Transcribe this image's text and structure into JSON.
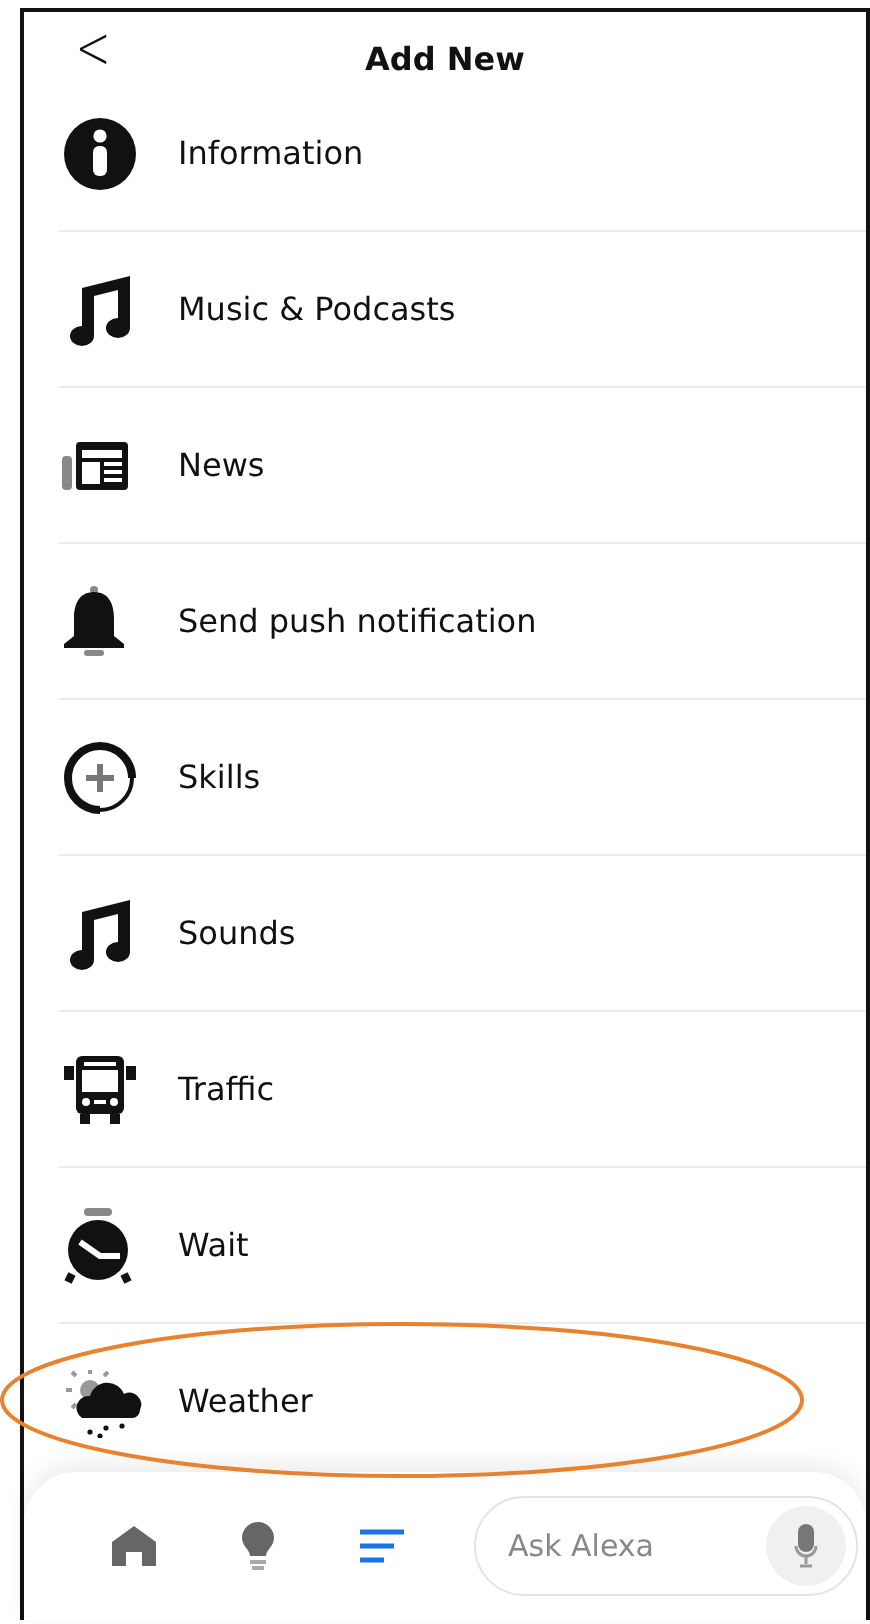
{
  "header": {
    "back": "<",
    "title": "Add New"
  },
  "items": [
    {
      "kind": "info",
      "label": "Information"
    },
    {
      "kind": "music",
      "label": "Music & Podcasts"
    },
    {
      "kind": "news",
      "label": "News"
    },
    {
      "kind": "bell",
      "label": "Send push notification"
    },
    {
      "kind": "skills",
      "label": "Skills"
    },
    {
      "kind": "music",
      "label": "Sounds"
    },
    {
      "kind": "bus",
      "label": "Traffic"
    },
    {
      "kind": "clock",
      "label": "Wait"
    },
    {
      "kind": "weather",
      "label": "Weather",
      "circled": true
    }
  ],
  "nav": [
    {
      "kind": "home",
      "selected": false
    },
    {
      "kind": "bulb",
      "selected": false
    },
    {
      "kind": "list",
      "selected": true
    }
  ],
  "ask": {
    "placeholder": "Ask Alexa"
  }
}
